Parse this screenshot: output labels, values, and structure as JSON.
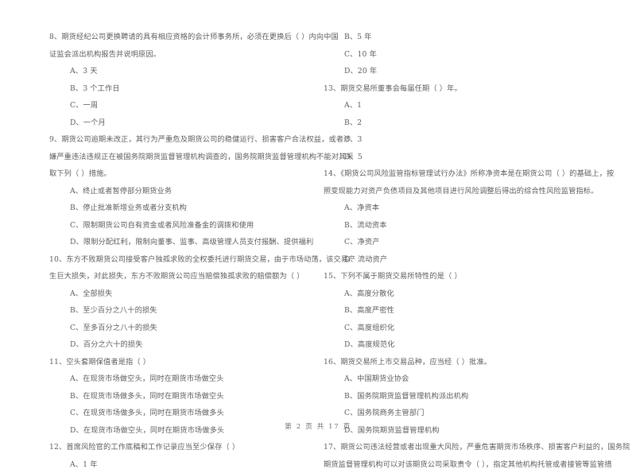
{
  "document": {
    "footer": "第 2 页 共 17 页"
  },
  "left_column": [
    {
      "id": "q8",
      "stem_lines": [
        "8、期货经纪公司更换聘请的具有相应资格的会计师事务所，必须在更换后（    ）内向中国",
        "证监会派出机构报告并说明原因。"
      ],
      "options": [
        "A、3 天",
        "B、3 个工作日",
        "C、一周",
        "D、一个月"
      ]
    },
    {
      "id": "q9",
      "stem_lines": [
        "9、期货公司逾期未改正，其行为严重危及期货公司的稳健运行、损害客户合法权益，或者涉",
        "嫌严重违法违规正在被国务院期货监督管理机构调查的，国务院期货监督管理机构不能对其采",
        "取下列（    ）措施。"
      ],
      "options": [
        "A、终止或者暂停部分期货业务",
        "B、停止批准新增业务或者分支机构",
        "C、限制期货公司自有资金或者风险准备金的调拨和使用",
        "D、限制分配红利，限制向董事、监事、高级管理人员支付报酬、提供福利"
      ]
    },
    {
      "id": "q10",
      "stem_lines": [
        "10、东方不败期货公司接受客户独孤求败的全权委托进行期货交易，由于市场动荡，该交易产",
        "生巨大损失，对此损失，东方不败期货公司应当赔偿独孤求败的赔偿额为（    ）"
      ],
      "options": [
        "A、全部损失",
        "B、至少百分之八十的损失",
        "C、至多百分之八十的损失",
        "D、百分之六十的损失"
      ]
    },
    {
      "id": "q11",
      "stem_lines": [
        "11、空头套期保值者是指（    ）"
      ],
      "options": [
        "A、在现货市场做空头，同时在期货市场做空头",
        "B、在现货市场做多头，同时在期货市场做空头",
        "C、在现货市场做多头，同时在期货市场做多头",
        "D、在现货市场做空头，同时在期货市场做多头"
      ]
    },
    {
      "id": "q12",
      "stem_lines": [
        "12、首席风险官的工作底稿和工作记录应当至少保存（    ）"
      ],
      "options": [
        "A、1 年"
      ]
    }
  ],
  "right_column": [
    {
      "id": "q12-cont",
      "stem_lines": [],
      "options": [
        "B、5 年",
        "C、10 年",
        "D、20 年"
      ]
    },
    {
      "id": "q13",
      "stem_lines": [
        "13、期货交易所董事会每届任期（    ）年。"
      ],
      "options": [
        "A、1",
        "B、2",
        "C、3",
        "D、5"
      ]
    },
    {
      "id": "q14",
      "stem_lines": [
        "14、《期货公司风险监管指标管理试行办法》所称净资本是在期货公司（    ）的基础上，按",
        "照变现能力对资产负债项目及其他项目进行风险调整后得出的综合性风险监管指标。"
      ],
      "options": [
        "A、净资本",
        "B、流动资本",
        "C、净资产",
        "D、流动资产"
      ]
    },
    {
      "id": "q15",
      "stem_lines": [
        "15、下列不属于期货交易所特性的是（    ）"
      ],
      "options": [
        "A、高度分散化",
        "B、高度严密性",
        "C、高度组织化",
        "D、高度规范化"
      ]
    },
    {
      "id": "q16",
      "stem_lines": [
        "16、期货交易所上市交易品种，应当经（    ）批准。"
      ],
      "options": [
        "A、中国期货业协会",
        "B、国务院期货监督管理机构派出机构",
        "C、国务院商务主管部门",
        "D、国务院期货监督管理机构"
      ]
    },
    {
      "id": "q17",
      "stem_lines": [
        "17、期货公司违法经营或者出现重大风险，严重危害期货市场秩序、损害客户利益的，国务院",
        "期货监督管理机构可以对该期货公司采取责令（    ），指定其他机构托管或者接管等监管措"
      ],
      "options": []
    }
  ]
}
